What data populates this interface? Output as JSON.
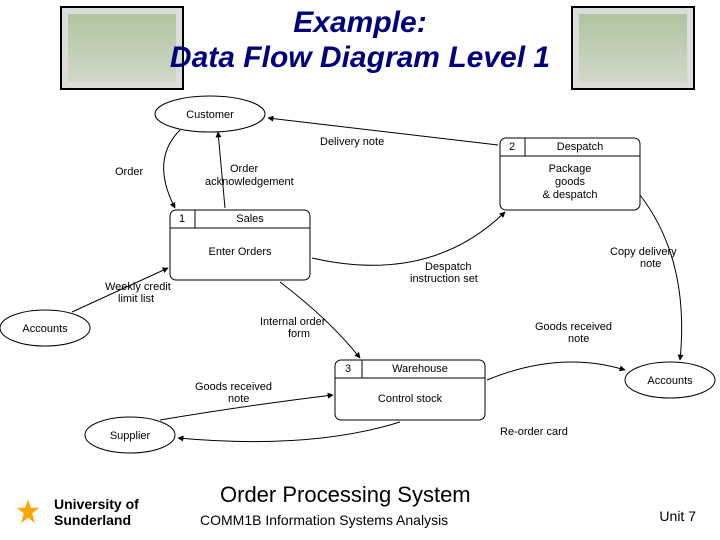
{
  "title_line1": "Example:",
  "title_line2": "Data Flow Diagram Level 1",
  "externals": {
    "customer": "Customer",
    "accounts_left": "Accounts",
    "accounts_right": "Accounts",
    "supplier": "Supplier"
  },
  "processes": {
    "p1": {
      "num": "1",
      "dept": "Sales",
      "name": "Enter Orders"
    },
    "p2": {
      "num": "2",
      "dept": "Despatch",
      "name_l1": "Package",
      "name_l2": "goods",
      "name_l3": "& despatch"
    },
    "p3": {
      "num": "3",
      "dept": "Warehouse",
      "name": "Control stock"
    }
  },
  "flows": {
    "order": "Order",
    "order_ack": "Order\nacknowledgement",
    "delivery_note": "Delivery note",
    "weekly_credit": "Weekly credit\nlimit list",
    "internal_order": "Internal order\nform",
    "despatch_instr": "Despatch\ninstruction set",
    "copy_delivery": "Copy delivery\nnote",
    "goods_recv1": "Goods received\nnote",
    "goods_recv2": "Goods received\nnote",
    "reorder": "Re-order card"
  },
  "footer": {
    "uni_l1": "University of",
    "uni_l2": "Sunderland",
    "title": "Order Processing System",
    "sub": "COMM1B Information Systems Analysis",
    "unit": "Unit 7"
  }
}
